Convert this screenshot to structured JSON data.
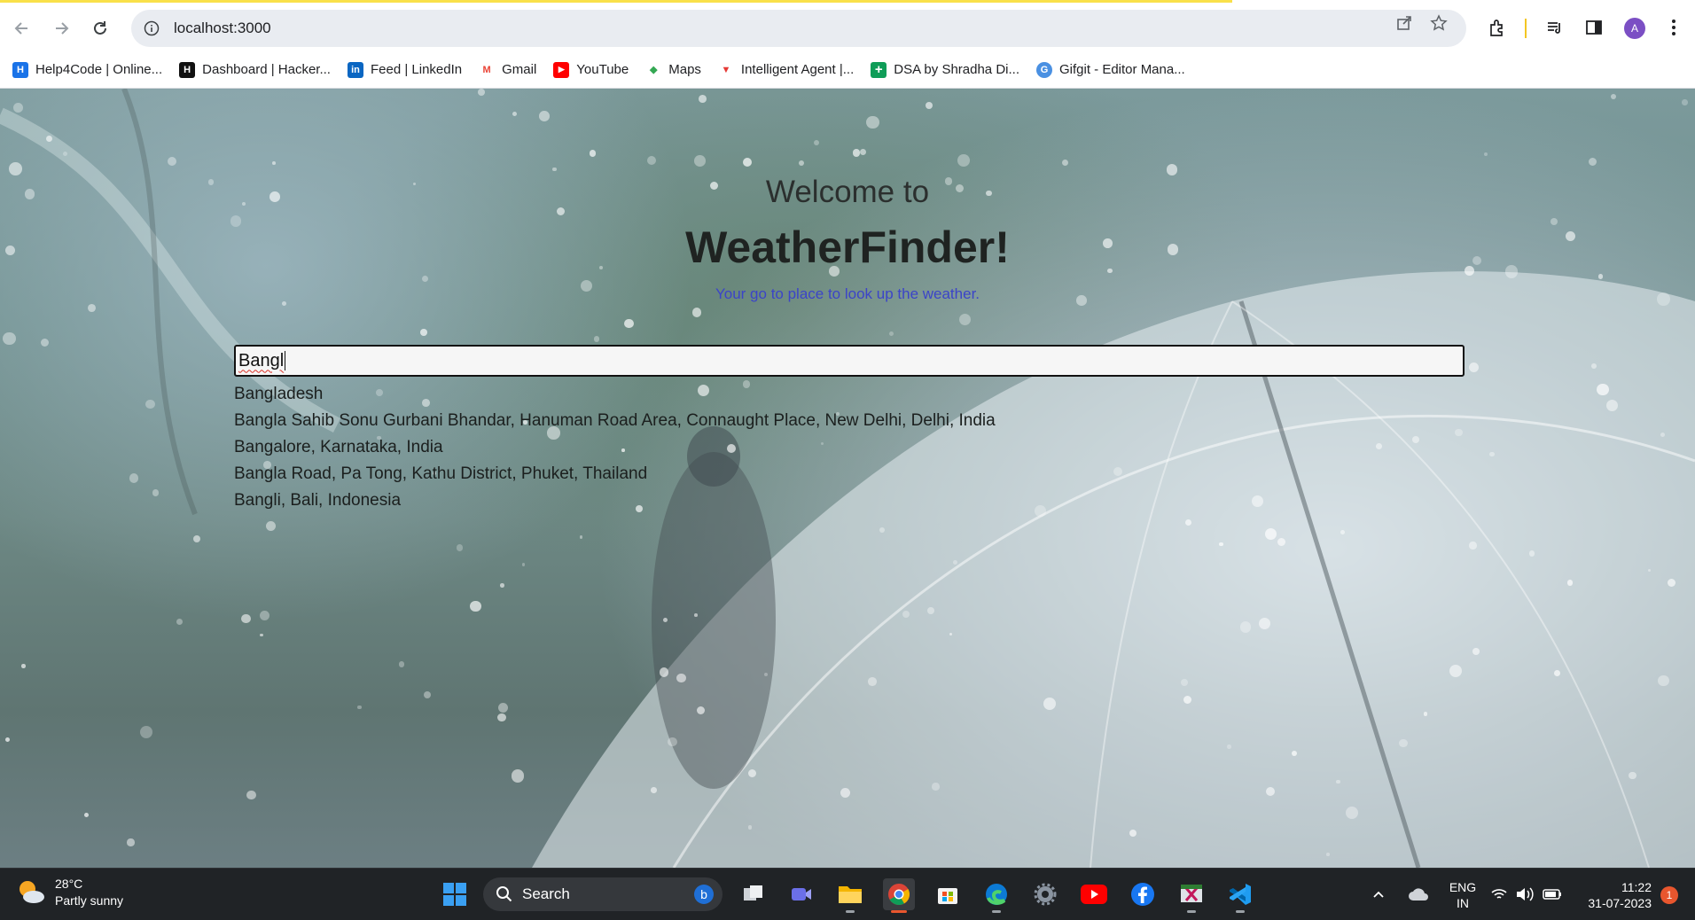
{
  "browser": {
    "url": "localhost:3000",
    "avatar_letter": "A",
    "bookmarks": [
      {
        "label": "Help4Code | Online...",
        "color": "#1a73e8",
        "glyph": "H"
      },
      {
        "label": "Dashboard | Hacker...",
        "color": "#111111",
        "glyph": "H"
      },
      {
        "label": "Feed | LinkedIn",
        "color": "#0a66c2",
        "glyph": "in"
      },
      {
        "label": "Gmail",
        "color": "#ea4335",
        "glyph": "M"
      },
      {
        "label": "YouTube",
        "color": "#ff0000",
        "glyph": "▶"
      },
      {
        "label": "Maps",
        "color": "#34a853",
        "glyph": "◆"
      },
      {
        "label": "Intelligent Agent |...",
        "color": "#e53935",
        "glyph": "▼"
      },
      {
        "label": "DSA by Shradha Di...",
        "color": "#0f9d58",
        "glyph": "+"
      },
      {
        "label": "Gifgit - Editor Mana...",
        "color": "#4a90e2",
        "glyph": "G"
      }
    ]
  },
  "page": {
    "welcome": "Welcome to",
    "brand": "WeatherFinder!",
    "tagline": "Your go to place to look up the weather.",
    "search_value": "Bangl",
    "suggestions": [
      "Bangladesh",
      "Bangla Sahib Sonu Gurbani Bhandar, Hanuman Road Area, Connaught Place, New Delhi, Delhi, India",
      "Bangalore, Karnataka, India",
      "Bangla Road, Pa Tong, Kathu District, Phuket, Thailand",
      "Bangli, Bali, Indonesia"
    ]
  },
  "taskbar": {
    "weather_temp": "28°C",
    "weather_desc": "Partly sunny",
    "search_label": "Search",
    "lang_top": "ENG",
    "lang_bottom": "IN",
    "time": "11:22",
    "date": "31-07-2023",
    "notification_count": "1"
  },
  "colors": {
    "tagline": "#3b44c8",
    "taskbar": "#202326",
    "load_bar": "#f9e04a"
  }
}
